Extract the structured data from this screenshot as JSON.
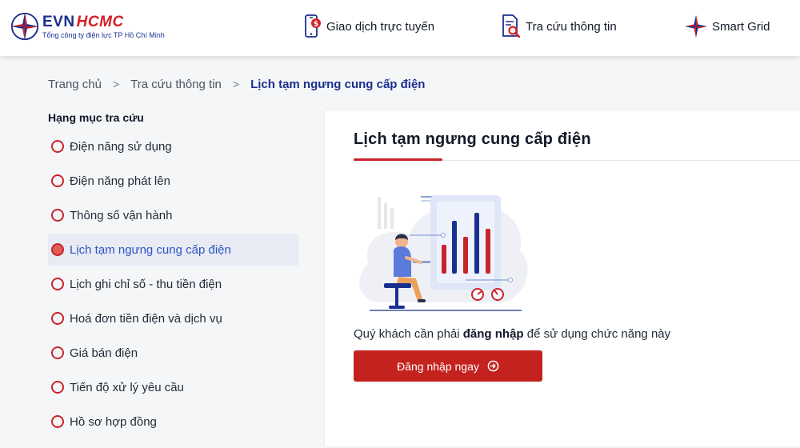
{
  "header": {
    "logo": {
      "brand_evn": "EVN",
      "brand_hcmc": "HCMC",
      "subtitle": "Tổng công ty điện lực TP Hồ Chí Minh"
    },
    "nav": [
      {
        "label": "Giao dịch trực tuyến",
        "icon": "phone-payment-icon"
      },
      {
        "label": "Tra cứu thông tin",
        "icon": "document-search-icon"
      },
      {
        "label": "Smart Grid",
        "icon": "star-compass-icon"
      }
    ]
  },
  "breadcrumb": {
    "items": [
      "Trang chủ",
      "Tra cứu thông tin",
      "Lịch tạm ngưng cung cấp điện"
    ],
    "separator": ">"
  },
  "sidebar": {
    "title": "Hạng mục tra cứu",
    "items": [
      {
        "label": "Điện năng sử dụng"
      },
      {
        "label": "Điện năng phát lên"
      },
      {
        "label": "Thông số vận hành"
      },
      {
        "label": "Lịch tạm ngưng cung cấp điện"
      },
      {
        "label": "Lịch ghi chỉ số - thu tiền điện"
      },
      {
        "label": "Hoá đơn tiền điện và dịch vụ"
      },
      {
        "label": "Giá bán điện"
      },
      {
        "label": "Tiến độ xử lý yêu cầu"
      },
      {
        "label": "Hồ sơ hợp đồng"
      }
    ],
    "active_index": 3
  },
  "content": {
    "title": "Lịch tạm ngưng cung cấp điện",
    "notice_prefix": "Quý khách cần phải ",
    "notice_bold": "đăng nhập",
    "notice_suffix": " để sử dụng chức năng này",
    "login_button": "Đăng nhập ngay"
  },
  "colors": {
    "brand_blue": "#1b2f8e",
    "brand_red": "#c8242b",
    "button_red": "#c4221f",
    "active_text": "#2f55c7"
  }
}
